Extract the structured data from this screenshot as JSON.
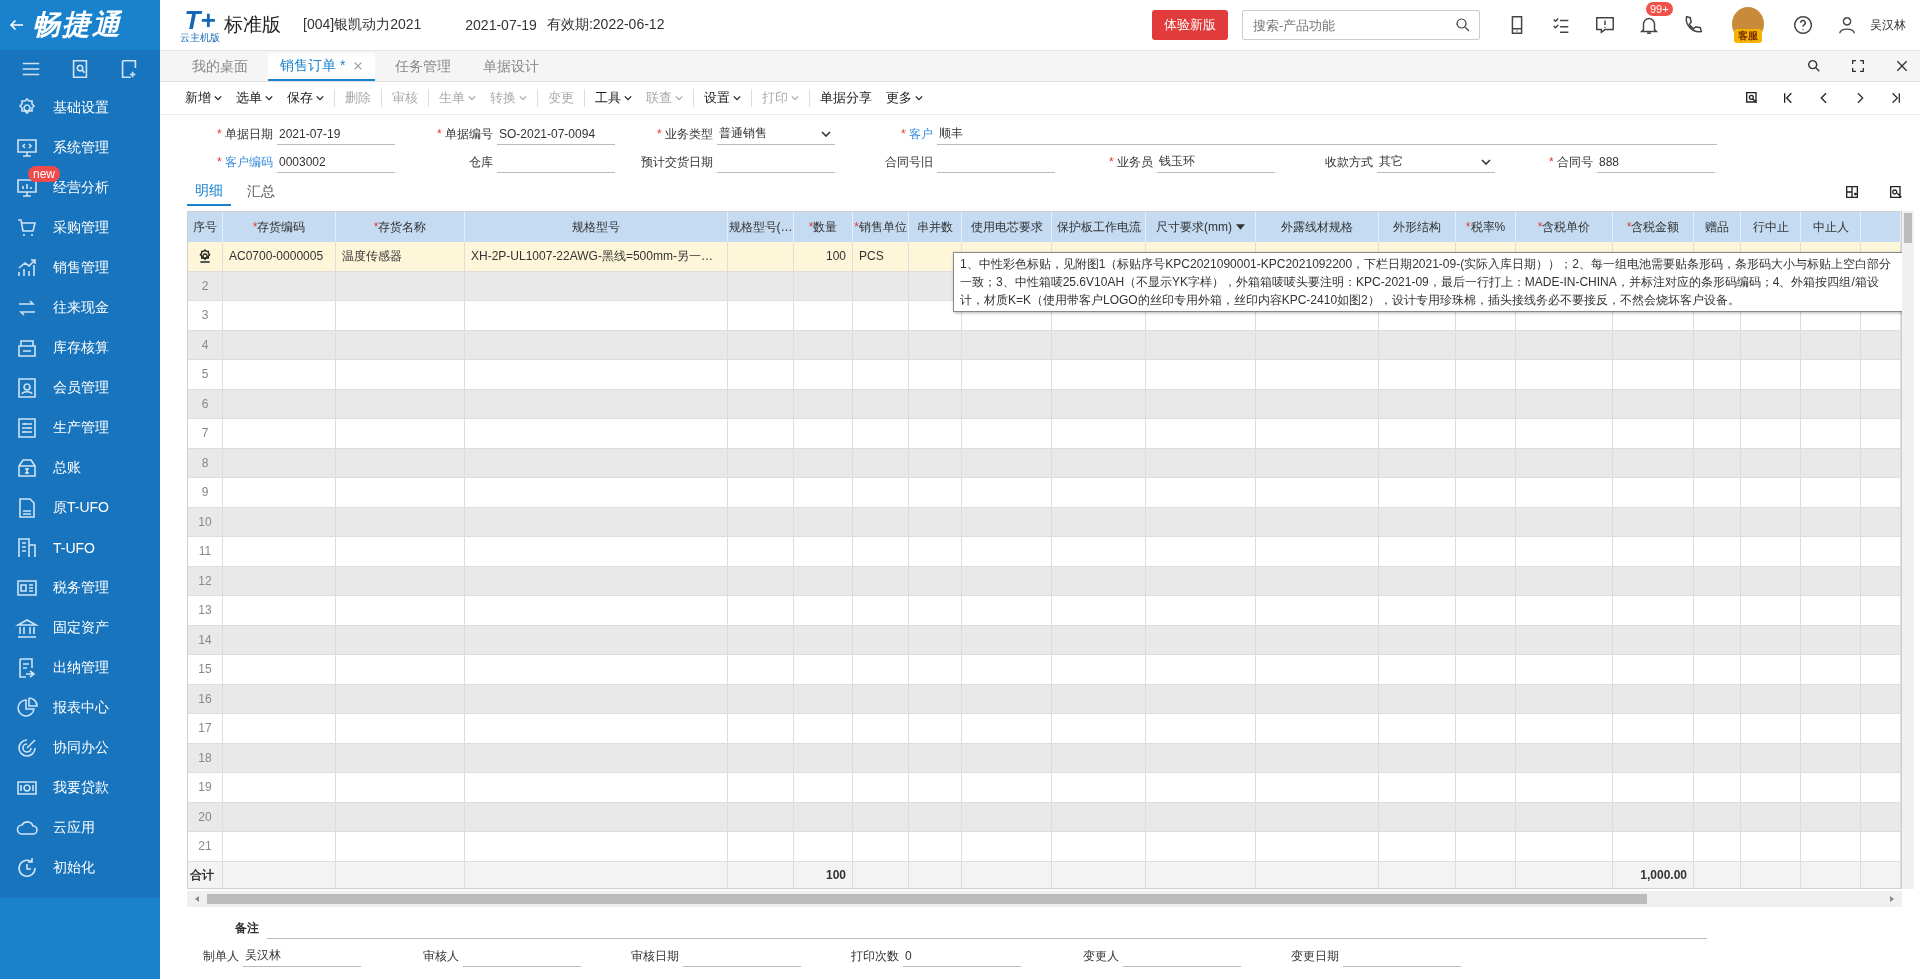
{
  "app": {
    "logo": "畅捷通"
  },
  "sidebar": {
    "items": [
      {
        "label": "基础设置"
      },
      {
        "label": "系统管理"
      },
      {
        "label": "经营分析",
        "badge": "new"
      },
      {
        "label": "采购管理"
      },
      {
        "label": "销售管理"
      },
      {
        "label": "往来现金"
      },
      {
        "label": "库存核算"
      },
      {
        "label": "会员管理"
      },
      {
        "label": "生产管理"
      },
      {
        "label": "总账"
      },
      {
        "label": "原T-UFO"
      },
      {
        "label": "T-UFO"
      },
      {
        "label": "税务管理"
      },
      {
        "label": "固定资产"
      },
      {
        "label": "出纳管理"
      },
      {
        "label": "报表中心"
      },
      {
        "label": "协同办公"
      },
      {
        "label": "我要贷款"
      },
      {
        "label": "云应用"
      },
      {
        "label": "初始化"
      }
    ]
  },
  "header": {
    "product_mark": "T+",
    "edition_note": "云主机版",
    "edition": "标准版",
    "account": "[004]银凯动力2021",
    "date": "2021-07-19",
    "validity": "有效期:2022-06-12",
    "new_version_button": "体验新版",
    "search": {
      "placeholder": "搜索-产品功能"
    },
    "notification_badge": "99+",
    "service_label": "客服",
    "user": "吴汉林"
  },
  "tabs": [
    {
      "label": "我的桌面",
      "selected": false,
      "closable": false
    },
    {
      "label": "销售订单 *",
      "selected": true,
      "closable": true
    },
    {
      "label": "任务管理",
      "selected": false,
      "closable": false
    },
    {
      "label": "单据设计",
      "selected": false,
      "closable": false
    }
  ],
  "toolbar": [
    {
      "label": "新增",
      "dropdown": true,
      "disabled": false,
      "separator_before": false
    },
    {
      "label": "选单",
      "dropdown": true,
      "disabled": false,
      "separator_before": false
    },
    {
      "label": "保存",
      "dropdown": true,
      "disabled": false,
      "separator_before": false
    },
    {
      "label": "删除",
      "dropdown": false,
      "disabled": true,
      "separator_before": true
    },
    {
      "label": "审核",
      "dropdown": false,
      "disabled": true,
      "separator_before": true
    },
    {
      "label": "生单",
      "dropdown": true,
      "disabled": true,
      "separator_before": true
    },
    {
      "label": "转换",
      "dropdown": true,
      "disabled": true,
      "separator_before": false
    },
    {
      "label": "变更",
      "dropdown": false,
      "disabled": true,
      "separator_before": true
    },
    {
      "label": "工具",
      "dropdown": true,
      "disabled": false,
      "separator_before": true
    },
    {
      "label": "联查",
      "dropdown": true,
      "disabled": true,
      "separator_before": false
    },
    {
      "label": "设置",
      "dropdown": true,
      "disabled": false,
      "separator_before": true
    },
    {
      "label": "打印",
      "dropdown": true,
      "disabled": true,
      "separator_before": true
    },
    {
      "label": "单据分享",
      "dropdown": false,
      "disabled": false,
      "separator_before": true
    },
    {
      "label": "更多",
      "dropdown": true,
      "disabled": false,
      "separator_before": false
    }
  ],
  "form": {
    "fields": [
      {
        "label": "单据日期",
        "required_mark": "*",
        "link": false,
        "kind": "text",
        "value": "2021-07-19"
      },
      {
        "label": "单据编号",
        "required_mark": "*",
        "link": false,
        "kind": "text",
        "value": "SO-2021-07-0094"
      },
      {
        "label": "业务类型",
        "required_mark": "*",
        "link": false,
        "kind": "select",
        "value": "普通销售"
      },
      {
        "label": "客户",
        "required_mark": "*",
        "link": true,
        "kind": "wide",
        "value": "顺丰"
      },
      {
        "label": "客户编码",
        "required_mark": "*",
        "link": true,
        "kind": "text",
        "value": "0003002"
      },
      {
        "label": "仓库",
        "link": false,
        "kind": "text"
      },
      {
        "label": "预计交货日期",
        "link": false,
        "kind": "text"
      },
      {
        "label": "合同号旧",
        "link": false,
        "kind": "text"
      },
      {
        "label": "业务员",
        "required_mark": "*",
        "link": false,
        "kind": "text",
        "value": "钱玉环"
      },
      {
        "label": "收款方式",
        "link": false,
        "kind": "select",
        "value": "其它"
      },
      {
        "label": "合同号",
        "required_mark": "*",
        "link": false,
        "kind": "text",
        "value": "888"
      }
    ]
  },
  "detail_tabs": [
    {
      "label": "明细",
      "selected": true
    },
    {
      "label": "汇总",
      "selected": false
    }
  ],
  "table": {
    "columns": [
      {
        "label": "序号",
        "sortable": false
      },
      {
        "label": "存货编码",
        "required_mark": "*",
        "sortable": false
      },
      {
        "label": "存货名称",
        "required_mark": "*",
        "sortable": false
      },
      {
        "label": "规格型号",
        "sortable": false
      },
      {
        "label": "规格型号(…",
        "sortable": false
      },
      {
        "label": "数量",
        "required_mark": "*",
        "sortable": false
      },
      {
        "label": "销售单位",
        "required_mark": "*",
        "sortable": false
      },
      {
        "label": "串并数",
        "sortable": false
      },
      {
        "label": "使用电芯要求",
        "sortable": false
      },
      {
        "label": "保护板工作电流",
        "sortable": false
      },
      {
        "label": "尺寸要求(mm)",
        "sortable": true
      },
      {
        "label": "外露线材规格",
        "sortable": false
      },
      {
        "label": "外形结构",
        "sortable": false
      },
      {
        "label": "税率%",
        "required_mark": "*",
        "sortable": false
      },
      {
        "label": "含税单价",
        "required_mark": "*",
        "sortable": false
      },
      {
        "label": "含税金额",
        "required_mark": "*",
        "sortable": false
      },
      {
        "label": "赠品",
        "sortable": false
      },
      {
        "label": "行中止",
        "sortable": false
      },
      {
        "label": "中止人",
        "sortable": false
      }
    ],
    "rows": [
      {
        "selected": true,
        "code": "AC0700-0000005",
        "name": "温度传感器",
        "spec": "XH-2P-UL1007-22AWG-黑线=500mm-另一…",
        "qty": "100",
        "unit": "PCS"
      },
      {
        "selected": false,
        "number": "2"
      },
      {
        "selected": false,
        "number": "3"
      },
      {
        "selected": false,
        "number": "4"
      },
      {
        "selected": false,
        "number": "5"
      },
      {
        "selected": false,
        "number": "6"
      },
      {
        "selected": false,
        "number": "7"
      },
      {
        "selected": false,
        "number": "8"
      },
      {
        "selected": false,
        "number": "9"
      },
      {
        "selected": false,
        "number": "10"
      },
      {
        "selected": false,
        "number": "11"
      },
      {
        "selected": false,
        "number": "12"
      },
      {
        "selected": false,
        "number": "13"
      },
      {
        "selected": false,
        "number": "14"
      },
      {
        "selected": false,
        "number": "15"
      },
      {
        "selected": false,
        "number": "16"
      },
      {
        "selected": false,
        "number": "17"
      },
      {
        "selected": false,
        "number": "18"
      },
      {
        "selected": false,
        "number": "19"
      },
      {
        "selected": false,
        "number": "20"
      },
      {
        "selected": false,
        "number": "21"
      }
    ],
    "totals": {
      "number": "合计",
      "qty": "100",
      "amount": "1,000.00"
    },
    "tooltip": "1、中性彩色标贴，见附图1（标贴序号KPC2021090001-KPC2021092200，下栏日期2021-09-(实际入库日期））；2、每一组电池需要贴条形码，条形码大小与标贴上空白部分一致；3、中性箱唛25.6V10AH（不显示YK字样），外箱箱唛唛头要注明：KPC-2021-09，最后一行打上：MADE-IN-CHINA，并标注对应的条形码编码；4、外箱按四组/箱设计，材质K=K（使用带客户LOGO的丝印专用外箱，丝印内容KPC-2410如图2），设计专用珍珠棉，插头接线务必不要接反，不然会烧坏客户设备。"
  },
  "footer": {
    "remark_label": "备注",
    "fields": [
      {
        "label": "制单人",
        "value": "吴汉林"
      },
      {
        "label": "审核人"
      },
      {
        "label": "审核日期"
      },
      {
        "label": "打印次数",
        "value": "0"
      },
      {
        "label": "变更人"
      },
      {
        "label": "变更日期"
      }
    ]
  }
}
